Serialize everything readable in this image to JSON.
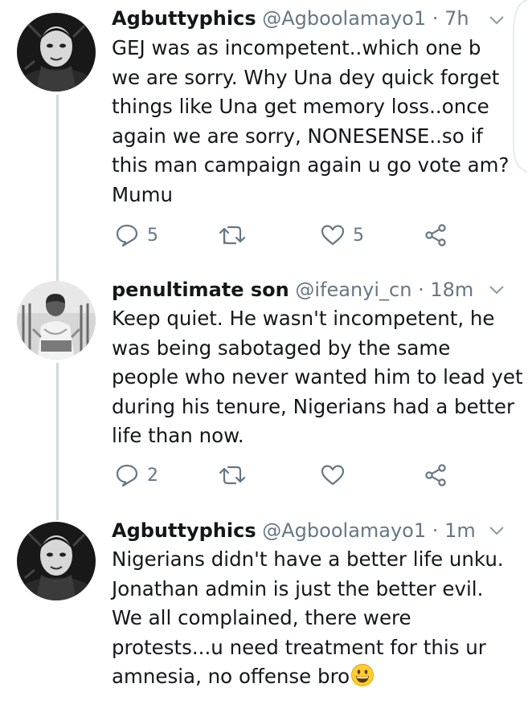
{
  "tweets": [
    {
      "display_name": "Agbuttyphics",
      "handle": "@Agboolamayo1",
      "separator": "·",
      "timestamp": "7h",
      "body_lines": [
        "GEJ was as incompetent..which one b",
        "we are sorry. Why Una dey quick forget",
        "things like Una get memory loss..once",
        "again we are sorry, NONESENSE..so if",
        "this man campaign again u go vote am?",
        "Mumu"
      ],
      "reply_count": "5",
      "retweet_count": "",
      "like_count": "5"
    },
    {
      "display_name": "penultimate son",
      "handle": "@ifeanyi_cn",
      "separator": "·",
      "timestamp": "18m",
      "body_lines": [
        "Keep quiet. He wasn't incompetent, he",
        "was being sabotaged by the same",
        "people who never wanted him to lead yet",
        "during his tenure, Nigerians had a better",
        "life than now."
      ],
      "reply_count": "2",
      "retweet_count": "",
      "like_count": ""
    },
    {
      "display_name": "Agbuttyphics",
      "handle": "@Agboolamayo1",
      "separator": "·",
      "timestamp": "1m",
      "body_lines": [
        "Nigerians didn't have a better life unku.",
        "Jonathan admin is just the better evil.",
        "We all complained, there were",
        "protests...u need treatment for this ur",
        "amnesia, no offense bro"
      ],
      "trailing_emoji": "grinning-face-emoji"
    }
  ],
  "colors": {
    "text": "#14171a",
    "secondary": "#657786",
    "thread_line": "#cfd9de"
  }
}
